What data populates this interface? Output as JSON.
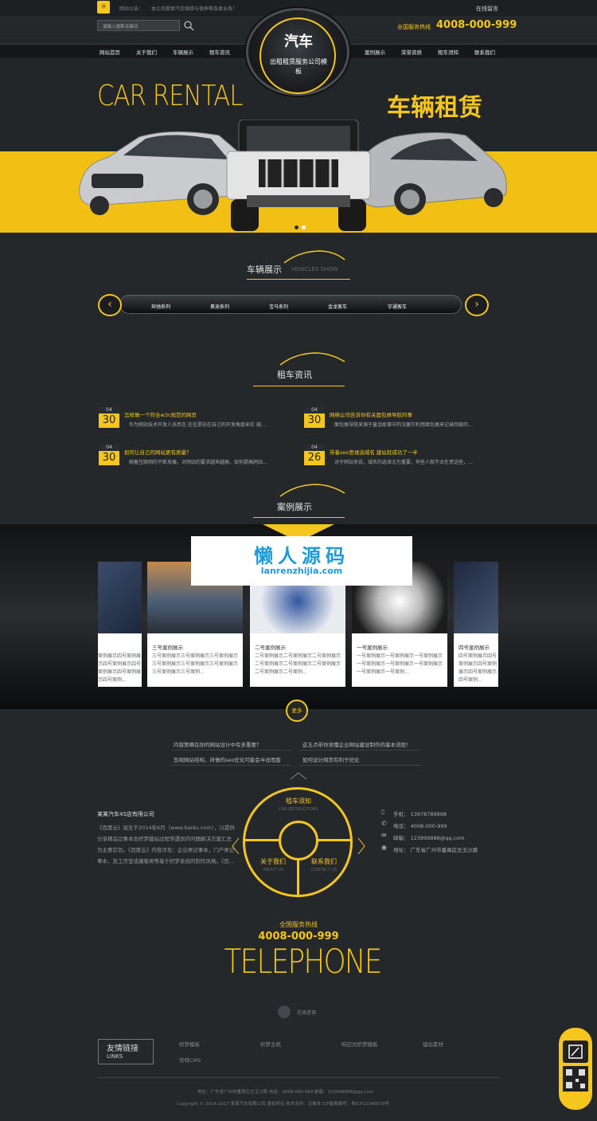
{
  "top": {
    "notice_label": "网站公告：",
    "notice_text": "本公司提供汽车维修与保养等各类业务！",
    "message_link": "在线留言",
    "search_placeholder": "请输入搜索关键词",
    "hotline_label": "全国服务热线",
    "hotline_number": "4008-000-999"
  },
  "nav": {
    "items_left": [
      "网站首页",
      "关于我们",
      "车辆展示",
      "租车资讯"
    ],
    "items_right": [
      "案例展示",
      "荣誉资质",
      "租车须知",
      "联系我们"
    ]
  },
  "logo": {
    "title": "汽车",
    "subtitle": "出租租赁服务公司模板"
  },
  "hero": {
    "en": "CAR RENTAL",
    "cn": "车辆租赁"
  },
  "vehicles": {
    "title": "车辆展示",
    "subtitle": "VEHICLES SHOW",
    "items": [
      "奔驰系列",
      "奥迪系列",
      "宝马系列",
      "金龙客车",
      "宇通客车"
    ]
  },
  "news": {
    "title": "租车资讯",
    "items": [
      {
        "month": "04",
        "day": "30",
        "title": "怎样做一个符合w3c规范的网页",
        "desc": "作为网站技术开发人员而言,往往是站在自己的开发角度来实 施..."
      },
      {
        "month": "04",
        "day": "30",
        "title": "网络公司告诉你有关面包屑导航的事",
        "desc": "面包屑导航来源于童话故事中的汉塞尔利用面包屑来记录回家的..."
      },
      {
        "month": "04",
        "day": "30",
        "title": "如何让自己的网站更有质量？",
        "desc": "随着互联网的不断发展，对网站的要求越来越高，如何提高网站..."
      },
      {
        "month": "04",
        "day": "26",
        "title": "带着seo思维选域名 建站就成功了一半",
        "desc": "对于网站来说，域名的选择尤为重要，有些人就不太在意这些，..."
      }
    ]
  },
  "cases": {
    "title": "案例展示",
    "more": "更多",
    "items": [
      {
        "name": "",
        "desc": "案例展示四号案例展示四号案例展示四号案例展示四号案例展示四号案例..."
      },
      {
        "name": "三号案例展示",
        "desc": "三号案例展示三号案例展示三号案例展示三号案例展示三号案例展示三号案例展示三号案例展示三号案例..."
      },
      {
        "name": "二号案例展示",
        "desc": "二号案例展示二号案例展示二号案例展示二号案例展示二号案例展示二号案例展示二号案例展示二号案例..."
      },
      {
        "name": "一号案例展示",
        "desc": "一号案例展示一号案例展示一号案例展示一号案例展示一号案例展示一号案例展示一号案例展示一号案例..."
      },
      {
        "name": "四号案例展示",
        "desc": "四号案例展示四号案例展示四号案例展示四号案例展示四号案例..."
      }
    ]
  },
  "watermark": {
    "title": "懒人源码",
    "sub": "lanrenzhijia.com"
  },
  "articles": {
    "left": [
      "内容策略在你的网站设计中有多重要？",
      "忽视网站结构，所做的seo优化可能会半途而废"
    ],
    "right": [
      "这五点带你读懂企业网站建设制作的基本流程！",
      "如何设计网页有利于优化"
    ]
  },
  "company": {
    "name": "某某汽车4S店有限公司",
    "desc": "《百度云》诞生于2014年6月（www.baidu.com），以提供分享精品记事本及织梦建站过程常遇到的问题解决方案汇总为主要宗旨。《百度云》内容涉及：企业类记事本，门户类记事本，及工作室或播客类等基于织梦系统的制作风格。《百..."
  },
  "wheel": {
    "top": "租车须知",
    "top_en": "CAR INSTRUCTIONS",
    "left": "关于我们",
    "left_en": "ABOUT US",
    "right": "联系我们",
    "right_en": "CONTACT US"
  },
  "contact": {
    "mobile": "手机：    13978789898",
    "phone": "电话：    4008-000-999",
    "email": "邮箱：    123999888@qq.com",
    "address": "地址：    广东省广州市番禺区左玉沙路"
  },
  "telephone": {
    "label": "全国服务热线",
    "number": "4008-000-999",
    "big": "TELEPHONE",
    "online": "在线咨询"
  },
  "links": {
    "cn": "友情链接",
    "en": "LINKS",
    "items": [
      "织梦模板",
      "织梦主机",
      "响应式织梦模板",
      "建站素材",
      "帝特CMS"
    ]
  },
  "footer": {
    "line1": "地址：广东省广州市番禺区左玉沙路        电话：4008-000-999        邮箱：123999888@qq.com",
    "line2": "Copyright © 2014-2017 某某汽车有限公司 版权所有        技术支持：记事本        ICP备案编号：粤ICP12345678号"
  },
  "colors": {
    "accent": "#f5c61d",
    "background": "#25282b"
  }
}
